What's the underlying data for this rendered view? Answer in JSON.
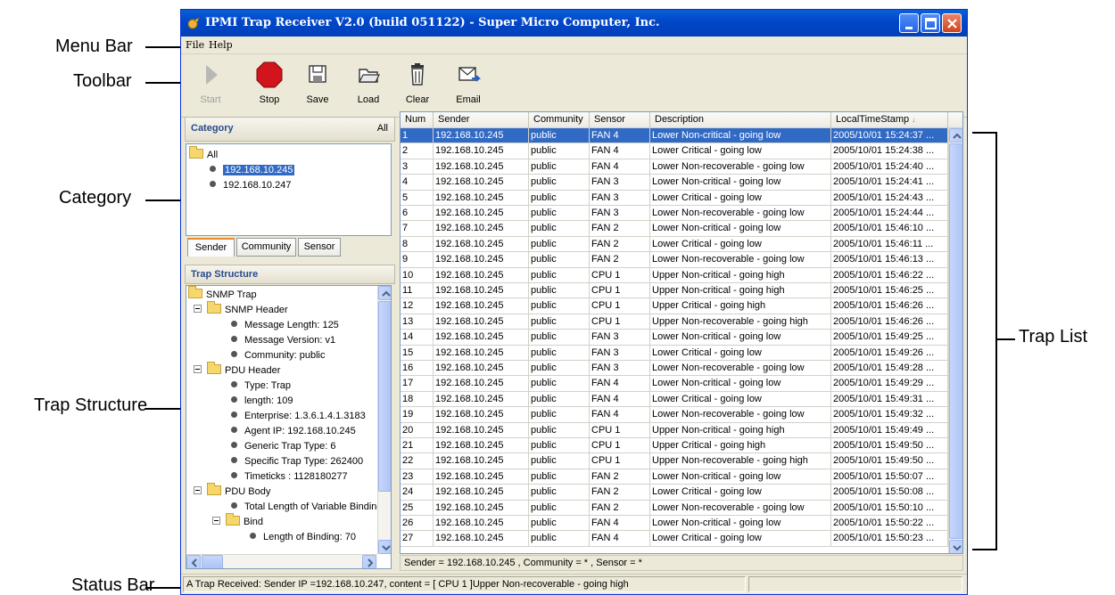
{
  "callouts": {
    "menu_bar": "Menu Bar",
    "toolbar": "Toolbar",
    "category": "Category",
    "trap_structure": "Trap Structure",
    "status_bar": "Status Bar",
    "trap_list": "Trap List"
  },
  "window": {
    "title": "IPMI Trap Receiver V2.0 (build 051122) - Super Micro Computer, Inc.",
    "controls": [
      "minimize-icon",
      "maximize-icon",
      "close-icon"
    ]
  },
  "menu": {
    "items": [
      "File",
      "Help"
    ]
  },
  "toolbar": {
    "start": "Start",
    "stop": "Stop",
    "save": "Save",
    "load": "Load",
    "clear": "Clear",
    "email": "Email"
  },
  "category": {
    "title": "Category",
    "all_label": "All",
    "root": "All",
    "items": [
      "192.168.10.245",
      "192.168.10.247"
    ],
    "selected": "192.168.10.245",
    "tabs": [
      "Sender",
      "Community",
      "Sensor"
    ],
    "active_tab": "Sender"
  },
  "trap_structure": {
    "title": "Trap Structure",
    "root": "SNMP Trap",
    "snmp_header": "SNMP Header",
    "message_length": "Message Length: 125",
    "message_version": "Message Version: v1",
    "community": "Community: public",
    "pdu_header": "PDU Header",
    "type": "Type: Trap",
    "length": "length: 109",
    "enterprise": "Enterprise: 1.3.6.1.4.1.3183",
    "agent_ip": "Agent IP: 192.168.10.245",
    "generic_trap": "Generic Trap Type: 6",
    "specific_trap": "Specific Trap Type: 262400",
    "timeticks": "Timeticks : 1128180277",
    "pdu_body": "PDU Body",
    "total_length": "Total Length of Variable Binding",
    "bind": "Bind",
    "length_of_binding": "Length of Binding: 70"
  },
  "trap_list": {
    "columns": [
      "Num",
      "Sender",
      "Community",
      "Sensor",
      "Description",
      "LocalTimeStamp"
    ],
    "sort_indicator": "↓",
    "selected_row": 1,
    "rows": [
      [
        "1",
        "192.168.10.245",
        "public",
        "FAN 4",
        "Lower Non-critical - going low",
        "2005/10/01 15:24:37 ..."
      ],
      [
        "2",
        "192.168.10.245",
        "public",
        "FAN 4",
        "Lower Critical - going low",
        "2005/10/01 15:24:38 ..."
      ],
      [
        "3",
        "192.168.10.245",
        "public",
        "FAN 4",
        "Lower Non-recoverable - going low",
        "2005/10/01 15:24:40 ..."
      ],
      [
        "4",
        "192.168.10.245",
        "public",
        "FAN 3",
        "Lower Non-critical - going low",
        "2005/10/01 15:24:41 ..."
      ],
      [
        "5",
        "192.168.10.245",
        "public",
        "FAN 3",
        "Lower Critical - going low",
        "2005/10/01 15:24:43 ..."
      ],
      [
        "6",
        "192.168.10.245",
        "public",
        "FAN 3",
        "Lower Non-recoverable - going low",
        "2005/10/01 15:24:44 ..."
      ],
      [
        "7",
        "192.168.10.245",
        "public",
        "FAN 2",
        "Lower Non-critical - going low",
        "2005/10/01 15:46:10 ..."
      ],
      [
        "8",
        "192.168.10.245",
        "public",
        "FAN 2",
        "Lower Critical - going low",
        "2005/10/01 15:46:11 ..."
      ],
      [
        "9",
        "192.168.10.245",
        "public",
        "FAN 2",
        "Lower Non-recoverable - going low",
        "2005/10/01 15:46:13 ..."
      ],
      [
        "10",
        "192.168.10.245",
        "public",
        "CPU 1",
        "Upper Non-critical - going high",
        "2005/10/01 15:46:22 ..."
      ],
      [
        "11",
        "192.168.10.245",
        "public",
        "CPU 1",
        "Upper Non-critical - going high",
        "2005/10/01 15:46:25 ..."
      ],
      [
        "12",
        "192.168.10.245",
        "public",
        "CPU 1",
        "Upper Critical - going high",
        "2005/10/01 15:46:26 ..."
      ],
      [
        "13",
        "192.168.10.245",
        "public",
        "CPU 1",
        "Upper Non-recoverable - going high",
        "2005/10/01 15:46:26 ..."
      ],
      [
        "14",
        "192.168.10.245",
        "public",
        "FAN 3",
        "Lower Non-critical - going low",
        "2005/10/01 15:49:25 ..."
      ],
      [
        "15",
        "192.168.10.245",
        "public",
        "FAN 3",
        "Lower Critical - going low",
        "2005/10/01 15:49:26 ..."
      ],
      [
        "16",
        "192.168.10.245",
        "public",
        "FAN 3",
        "Lower Non-recoverable - going low",
        "2005/10/01 15:49:28 ..."
      ],
      [
        "17",
        "192.168.10.245",
        "public",
        "FAN 4",
        "Lower Non-critical - going low",
        "2005/10/01 15:49:29 ..."
      ],
      [
        "18",
        "192.168.10.245",
        "public",
        "FAN 4",
        "Lower Critical - going low",
        "2005/10/01 15:49:31 ..."
      ],
      [
        "19",
        "192.168.10.245",
        "public",
        "FAN 4",
        "Lower Non-recoverable - going low",
        "2005/10/01 15:49:32 ..."
      ],
      [
        "20",
        "192.168.10.245",
        "public",
        "CPU 1",
        "Upper Non-critical - going high",
        "2005/10/01 15:49:49 ..."
      ],
      [
        "21",
        "192.168.10.245",
        "public",
        "CPU 1",
        "Upper Critical - going high",
        "2005/10/01 15:49:50 ..."
      ],
      [
        "22",
        "192.168.10.245",
        "public",
        "CPU 1",
        "Upper Non-recoverable - going high",
        "2005/10/01 15:49:50 ..."
      ],
      [
        "23",
        "192.168.10.245",
        "public",
        "FAN 2",
        "Lower Non-critical - going low",
        "2005/10/01 15:50:07 ..."
      ],
      [
        "24",
        "192.168.10.245",
        "public",
        "FAN 2",
        "Lower Critical - going low",
        "2005/10/01 15:50:08 ..."
      ],
      [
        "25",
        "192.168.10.245",
        "public",
        "FAN 2",
        "Lower Non-recoverable - going low",
        "2005/10/01 15:50:10 ..."
      ],
      [
        "26",
        "192.168.10.245",
        "public",
        "FAN 4",
        "Lower Non-critical - going low",
        "2005/10/01 15:50:22 ..."
      ],
      [
        "27",
        "192.168.10.245",
        "public",
        "FAN 4",
        "Lower Critical - going low",
        "2005/10/01 15:50:23 ..."
      ]
    ]
  },
  "filter_text": "Sender = 192.168.10.245 , Community = * , Sensor = *",
  "status": {
    "message": "A Trap Received: Sender IP =192.168.10.247, content = [ CPU 1 ]Upper Non-recoverable - going high",
    "secondary": ""
  },
  "colors": {
    "title_bar": "#0046c8",
    "selection": "#316ac5",
    "window_bg": "#ece9d8",
    "panel_title": "#2a4a8e",
    "stop_button": "#d2141c",
    "callout_line": "#000000"
  }
}
